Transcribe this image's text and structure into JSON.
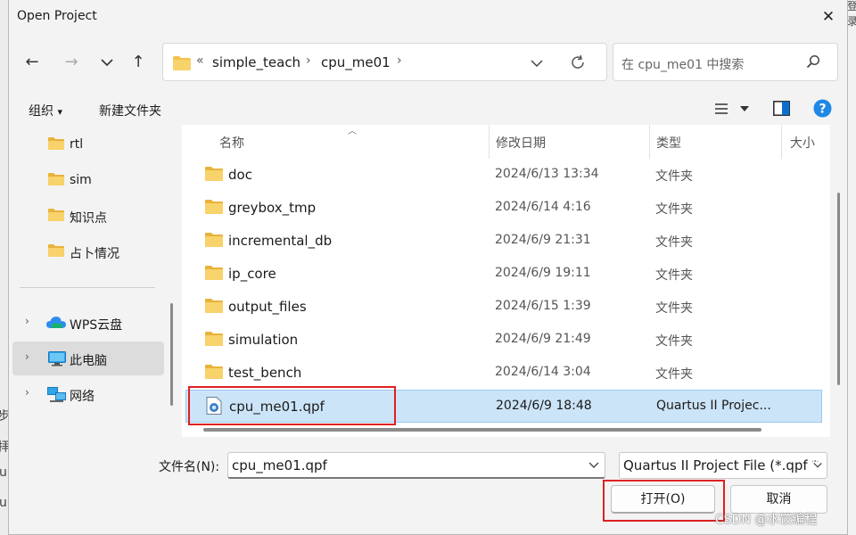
{
  "window": {
    "title": "Open Project",
    "close_glyph": "✕"
  },
  "nav": {
    "back": "←",
    "forward": "→",
    "recent": "⌄",
    "up": "↑"
  },
  "address": {
    "overflow": "«",
    "crumbs": [
      "simple_teach",
      "cpu_me01"
    ],
    "separator": "›"
  },
  "search": {
    "placeholder": "在 cpu_me01 中搜索"
  },
  "toolbar": {
    "organize": "组织",
    "organize_caret": "▾",
    "new_folder": "新建文件夹"
  },
  "sidebar": {
    "items": [
      {
        "label": "rtl",
        "icon": "folder-icon"
      },
      {
        "label": "sim",
        "icon": "folder-icon"
      },
      {
        "label": "知识点",
        "icon": "folder-icon"
      },
      {
        "label": "占卜情况",
        "icon": "folder-icon"
      },
      {
        "label": "WPS云盘",
        "icon": "cloud-icon"
      },
      {
        "label": "此电脑",
        "icon": "pc-icon",
        "selected": true
      },
      {
        "label": "网络",
        "icon": "network-icon"
      }
    ],
    "expand_glyph": "›"
  },
  "columns": {
    "name": "名称",
    "modified": "修改日期",
    "type": "类型",
    "size": "大小"
  },
  "files": [
    {
      "name": "doc",
      "modified": "2024/6/13 13:34",
      "type": "文件夹"
    },
    {
      "name": "greybox_tmp",
      "modified": "2024/6/14 4:16",
      "type": "文件夹"
    },
    {
      "name": "incremental_db",
      "modified": "2024/6/9 21:31",
      "type": "文件夹"
    },
    {
      "name": "ip_core",
      "modified": "2024/6/9 19:11",
      "type": "文件夹"
    },
    {
      "name": "output_files",
      "modified": "2024/6/15 1:39",
      "type": "文件夹"
    },
    {
      "name": "simulation",
      "modified": "2024/6/9 21:49",
      "type": "文件夹"
    },
    {
      "name": "test_bench",
      "modified": "2024/6/14 3:04",
      "type": "文件夹"
    },
    {
      "name": "cpu_me01.qpf",
      "modified": "2024/6/9 18:48",
      "type": "Quartus II Projec...",
      "selected": true
    }
  ],
  "filename": {
    "label": "文件名(N):",
    "value": "cpu_me01.qpf"
  },
  "filetype": {
    "value": "Quartus II Project File (*.qpf *"
  },
  "buttons": {
    "open": "打开(O)",
    "cancel": "取消"
  },
  "watermark": "CSDN @水饺编程",
  "background_fragments": [
    "步",
    "拝",
    "u",
    "u",
    "登录"
  ],
  "colors": {
    "accent": "#005fb8",
    "selection": "#cce4f7",
    "highlight_box": "#e02020",
    "folder": "#f4c24d"
  }
}
